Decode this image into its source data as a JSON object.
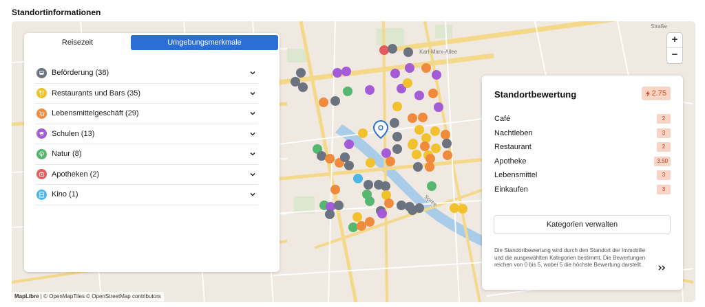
{
  "section_title": "Standortinformationen",
  "tabs": [
    {
      "label": "Reisezeit",
      "active": false
    },
    {
      "label": "Umgebungsmerkmale",
      "active": true
    }
  ],
  "categories": [
    {
      "label": "Beförderung (38)",
      "color": "#6b7280",
      "icon": "bus-icon"
    },
    {
      "label": "Restaurants und Bars (35)",
      "color": "#f2c12e",
      "icon": "fork-knife-icon"
    },
    {
      "label": "Lebensmittelgeschäft (29)",
      "color": "#f08a3c",
      "icon": "shopping-cart-icon"
    },
    {
      "label": "Schulen (13)",
      "color": "#a35bd8",
      "icon": "graduation-cap-icon"
    },
    {
      "label": "Natur (8)",
      "color": "#56b870",
      "icon": "tree-icon"
    },
    {
      "label": "Apotheken (2)",
      "color": "#e55a5a",
      "icon": "medical-bag-icon"
    },
    {
      "label": "Kino (1)",
      "color": "#4fb6e8",
      "icon": "film-icon"
    }
  ],
  "rating_panel": {
    "title": "Standortbewertung",
    "score": "2.75",
    "score_color": "#d9481c",
    "items": [
      {
        "name": "Café",
        "value": "2"
      },
      {
        "name": "Nachtleben",
        "value": "3"
      },
      {
        "name": "Restaurant",
        "value": "2"
      },
      {
        "name": "Apotheke",
        "value": "3.50"
      },
      {
        "name": "Lebensmittel",
        "value": "3"
      },
      {
        "name": "Einkaufen",
        "value": "3"
      }
    ],
    "manage_button": "Kategorien verwalten",
    "description": "Die Standortbewertung wird durch den Standort der Immobilie und die ausgewählten Kategorien bestimmt. Die Bewertungen reichen von 0 bis 5, wobei 5 die höchste Bewertung darstellt."
  },
  "map": {
    "zoom_in": "+",
    "zoom_out": "−",
    "attribution_brand": "MapLibre",
    "attribution_rest": "| © OpenMapTiles © OpenStreetMap contributors",
    "streets": [
      "Karl-Marx-Allee",
      "Straße",
      "Spree"
    ]
  }
}
